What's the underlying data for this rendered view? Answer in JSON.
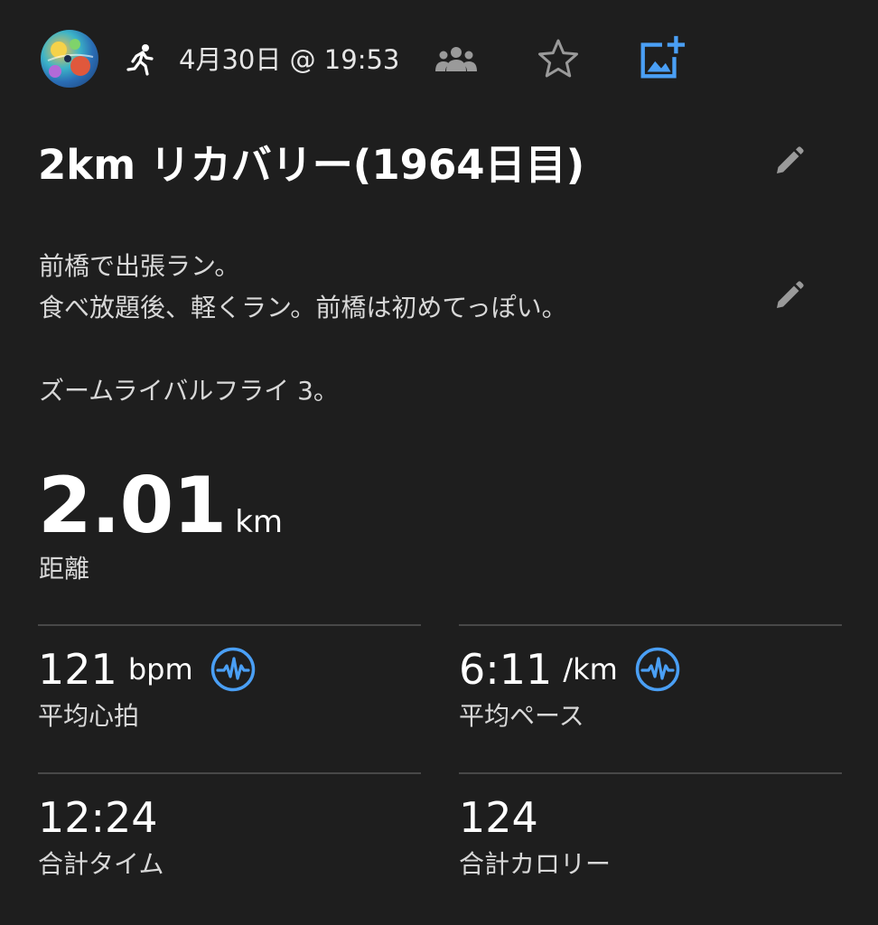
{
  "header": {
    "timestamp": "4月30日 @ 19:53",
    "icons": {
      "activity": "running-person-icon",
      "group": "group-people-icon",
      "favorite": "star-outline-icon",
      "add_photo": "add-photo-icon"
    },
    "accent_color": "#4a9ff5"
  },
  "activity": {
    "title": "2km リカバリー(1964日目)",
    "notes": [
      "前橋で出張ラン。",
      "食べ放題後、軽くラン。前橋は初めてっぽい。",
      "",
      "ズームライバルフライ 3。"
    ]
  },
  "distance": {
    "value": "2.01",
    "unit": "km",
    "label": "距離"
  },
  "stats": {
    "avg_heart_rate": {
      "value": "121",
      "unit": "bpm",
      "label": "平均心拍"
    },
    "avg_pace": {
      "value": "6:11",
      "unit": "/km",
      "label": "平均ペース"
    },
    "total_time": {
      "value": "12:24",
      "label": "合計タイム"
    },
    "total_calories": {
      "value": "124",
      "label": "合計カロリー"
    }
  }
}
